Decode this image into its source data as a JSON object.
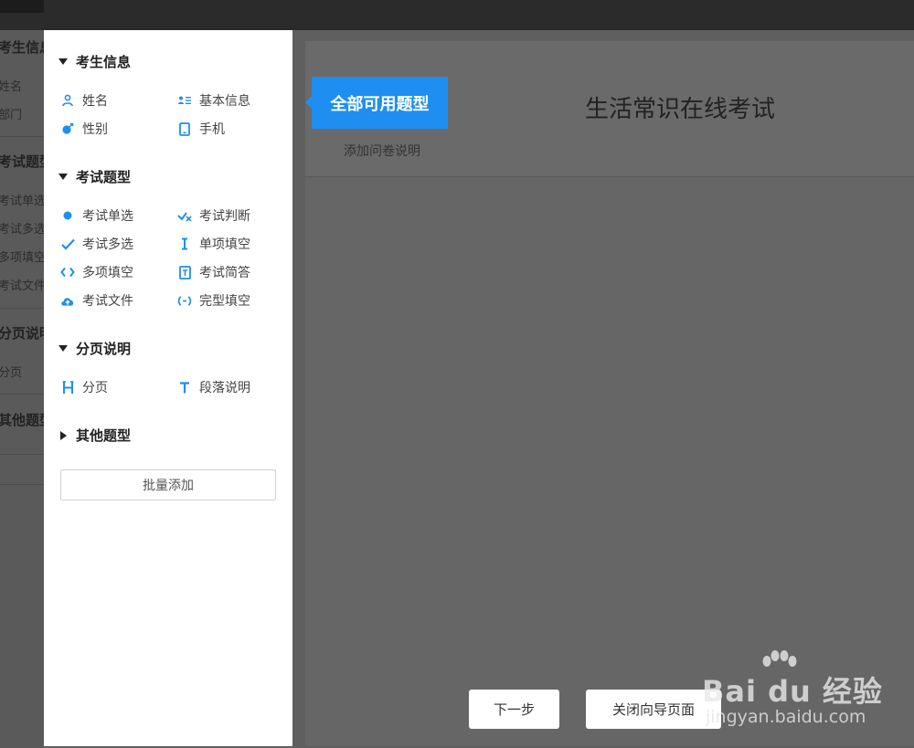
{
  "background_sidebar": {
    "sections": [
      {
        "label": "考生信息",
        "items": [
          "姓名",
          "部门"
        ]
      },
      {
        "label": "考试题型",
        "items": [
          "考试单选",
          "考试多选",
          "多项填空",
          "考试文件"
        ]
      },
      {
        "label": "分页说明",
        "items": [
          "分页"
        ]
      },
      {
        "label": "其他题型",
        "items": []
      }
    ]
  },
  "panel": {
    "sections": [
      {
        "label": "考生信息",
        "expanded": true,
        "items": [
          {
            "label": "姓名",
            "icon": "person-icon"
          },
          {
            "label": "基本信息",
            "icon": "id-card-icon"
          },
          {
            "label": "性别",
            "icon": "gender-icon"
          },
          {
            "label": "手机",
            "icon": "phone-icon"
          }
        ]
      },
      {
        "label": "考试题型",
        "expanded": true,
        "items": [
          {
            "label": "考试单选",
            "icon": "radio-dot-icon"
          },
          {
            "label": "考试判断",
            "icon": "check-cross-icon"
          },
          {
            "label": "考试多选",
            "icon": "checkmark-icon"
          },
          {
            "label": "单项填空",
            "icon": "text-cursor-icon"
          },
          {
            "label": "多项填空",
            "icon": "code-brackets-icon"
          },
          {
            "label": "考试简答",
            "icon": "doc-edit-icon"
          },
          {
            "label": "考试文件",
            "icon": "cloud-upload-icon"
          },
          {
            "label": "完型填空",
            "icon": "cloze-icon"
          }
        ]
      },
      {
        "label": "分页说明",
        "expanded": true,
        "items": [
          {
            "label": "分页",
            "icon": "page-break-icon"
          },
          {
            "label": "段落说明",
            "icon": "text-t-icon"
          }
        ]
      },
      {
        "label": "其他题型",
        "expanded": false,
        "items": []
      }
    ],
    "batch_add_label": "批量添加"
  },
  "tooltip": {
    "label": "全部可用题型"
  },
  "editor": {
    "title": "生活常识在线考试",
    "add_description": "添加问卷说明"
  },
  "guide_buttons": {
    "next": "下一步",
    "close": "关闭向导页面"
  },
  "watermark": {
    "brand": "Bai du 经验",
    "url": "jingyan.baidu.com"
  },
  "colors": {
    "accent": "#1e8ff0",
    "overlay": "#5f5f5f",
    "panel": "#ffffff"
  }
}
